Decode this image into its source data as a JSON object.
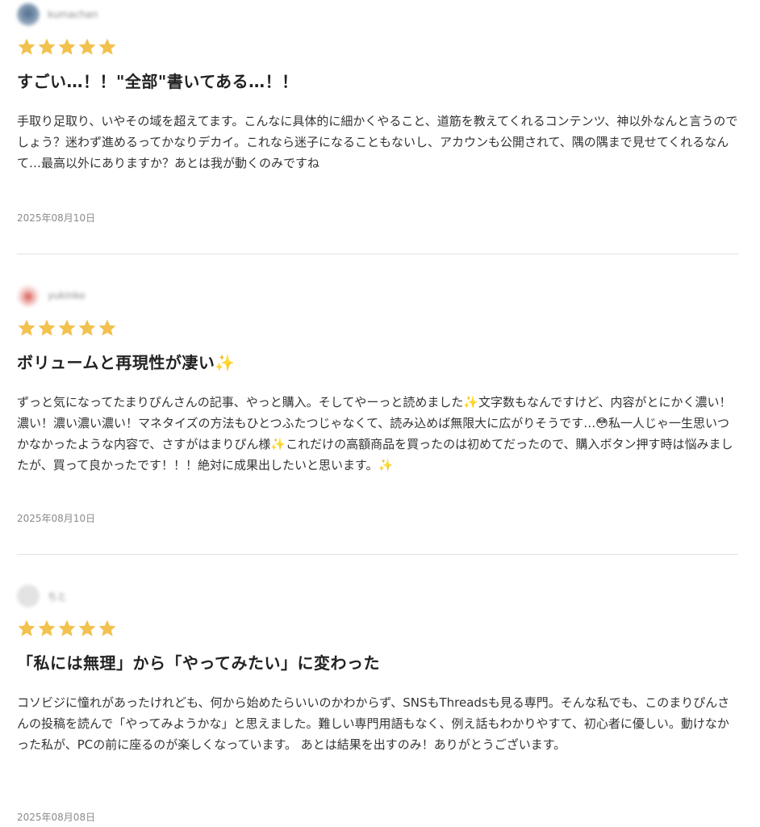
{
  "colors": {
    "star": "#f2c14e",
    "divider": "#e2e2e2",
    "date": "#8a8a8a"
  },
  "reviews": [
    {
      "author": "kumachan",
      "rating": 5,
      "title": "すごい…！！\"全部\"書いてある…！！",
      "body": "手取り足取り、いやその域を超えてます。こんなに具体的に細かくやること、道筋を教えてくれるコンテンツ、神以外なんと言うのでしょう？迷わず進めるってかなりデカイ。これなら迷子になることもないし、アカウンも公開されて、隅の隅まで見せてくれるなんて…最高以外にありますか？あとは我が動くのみですね",
      "date": "2025年08月10日"
    },
    {
      "author": "yukinko",
      "rating": 5,
      "title": "ボリュームと再現性が凄い✨",
      "body": "ずっと気になってたまりぴんさんの記事、やっと購入。そしてやーっと読めました✨文字数もなんですけど、内容がとにかく濃い！濃い！濃い濃い濃い！マネタイズの方法もひとつふたつじゃなくて、読み込めば無限大に広がりそうです…😳私一人じゃ一生思いつかなかったような内容で、さすがはまりぴん様✨これだけの高額商品を買ったのは初めてだったので、購入ボタン押す時は悩みましたが、買って良かったです！！！絶対に成果出したいと思います。✨",
      "date": "2025年08月10日"
    },
    {
      "author": "ちと",
      "rating": 5,
      "title": "「私には無理」から「やってみたい」に変わった",
      "body": "コソビジに憧れがあったけれども、何から始めたらいいのかわからず、SNSもThreadsも見る専門。そんな私でも、このまりぴんさんの投稿を読んで「やってみようかな」と思えました。難しい専門用語もなく、例え話もわかりやすて、初心者に優しい。動けなかった私が、PCの前に座るのが楽しくなっています。 あとは結果を出すのみ！ありがとうございます。",
      "date": "2025年08月08日"
    }
  ]
}
